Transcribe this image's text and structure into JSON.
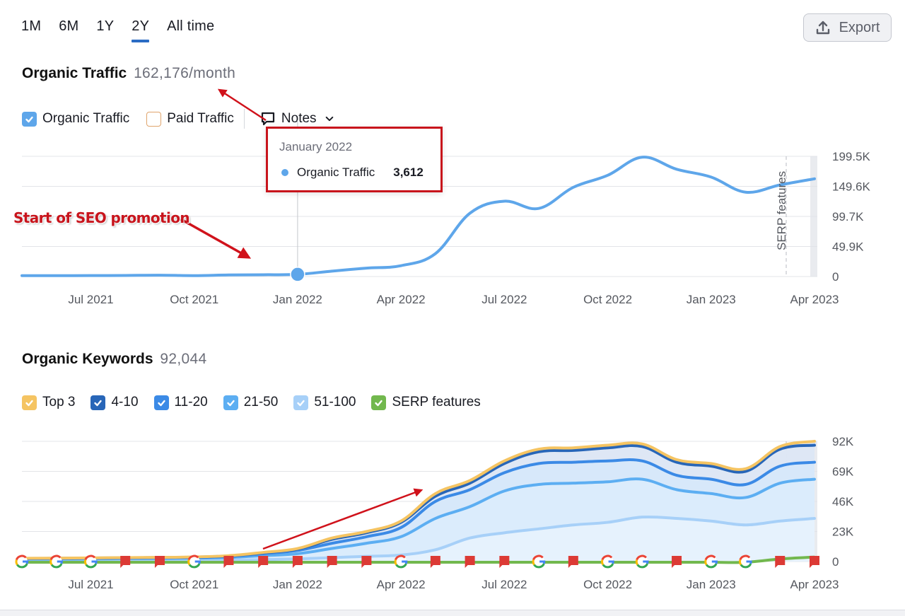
{
  "period_tabs": [
    {
      "label": "1M",
      "active": false
    },
    {
      "label": "6M",
      "active": false
    },
    {
      "label": "1Y",
      "active": false
    },
    {
      "label": "2Y",
      "active": true
    },
    {
      "label": "All time",
      "active": false
    }
  ],
  "export": {
    "label": "Export",
    "icon": "upload-icon"
  },
  "traffic": {
    "title": "Organic Traffic",
    "value": "162,176/month",
    "legend": {
      "organic": {
        "label": "Organic Traffic",
        "checked": true,
        "color": "#5ea6ea"
      },
      "paid": {
        "label": "Paid Traffic",
        "checked": false,
        "color": "#e0a46c"
      },
      "notes": {
        "label": "Notes",
        "icon": "comment-icon"
      }
    },
    "tooltip": {
      "date": "January 2022",
      "series": "Organic Traffic",
      "value": "3,612"
    },
    "annotation": "Start of SEO promotion",
    "serp_label": "SERP features"
  },
  "keywords": {
    "title": "Organic Keywords",
    "value": "92,044",
    "legend": [
      {
        "label": "Top 3",
        "color": "#f5c462"
      },
      {
        "label": "4-10",
        "color": "#2866b8"
      },
      {
        "label": "11-20",
        "color": "#3b8ae6"
      },
      {
        "label": "21-50",
        "color": "#5caef2"
      },
      {
        "label": "51-100",
        "color": "#a7d0f8"
      },
      {
        "label": "SERP features",
        "color": "#72b84e"
      }
    ]
  },
  "chart_data": [
    {
      "type": "line",
      "title": "Organic Traffic",
      "x": [
        "May 2021",
        "Jun 2021",
        "Jul 2021",
        "Aug 2021",
        "Sep 2021",
        "Oct 2021",
        "Nov 2021",
        "Dec 2021",
        "Jan 2022",
        "Feb 2022",
        "Mar 2022",
        "Apr 2022",
        "May 2022",
        "Jun 2022",
        "Jul 2022",
        "Aug 2022",
        "Sep 2022",
        "Oct 2022",
        "Nov 2022",
        "Dec 2022",
        "Jan 2023",
        "Feb 2023",
        "Mar 2023",
        "Apr 2023"
      ],
      "series": [
        {
          "name": "Organic Traffic",
          "color": "#5ea6ea",
          "values": [
            1500,
            1500,
            1600,
            1800,
            2200,
            1500,
            2600,
            3000,
            3612,
            9000,
            14000,
            18000,
            38000,
            105000,
            125000,
            113000,
            148000,
            168000,
            198000,
            178000,
            165000,
            140000,
            152000,
            162176
          ]
        }
      ],
      "xticks": [
        "Jul 2021",
        "Oct 2021",
        "Jan 2022",
        "Apr 2022",
        "Jul 2022",
        "Oct 2022",
        "Jan 2023",
        "Apr 2023"
      ],
      "yticks": [
        "0",
        "49.9K",
        "99.7K",
        "149.6K",
        "199.5K"
      ],
      "ylim": [
        0,
        199500
      ],
      "grid": true,
      "highlight": {
        "x": "Jan 2022",
        "value": 3612
      }
    },
    {
      "type": "area",
      "title": "Organic Keywords",
      "x": [
        "May 2021",
        "Jun 2021",
        "Jul 2021",
        "Aug 2021",
        "Sep 2021",
        "Oct 2021",
        "Nov 2021",
        "Dec 2021",
        "Jan 2022",
        "Feb 2022",
        "Mar 2022",
        "Apr 2022",
        "May 2022",
        "Jun 2022",
        "Jul 2022",
        "Aug 2022",
        "Sep 2022",
        "Oct 2022",
        "Nov 2022",
        "Dec 2022",
        "Jan 2023",
        "Feb 2023",
        "Mar 2023",
        "Apr 2023"
      ],
      "series": [
        {
          "name": "Top 3 (cumulative)",
          "color": "#f5c462",
          "values": [
            2500,
            2600,
            2800,
            3000,
            3200,
            3500,
            4500,
            7000,
            10000,
            18000,
            23000,
            31000,
            52000,
            62000,
            77000,
            86000,
            87000,
            89000,
            90000,
            78000,
            75000,
            71000,
            88000,
            92044
          ]
        },
        {
          "name": "4-10 (cumulative)",
          "color": "#2866b8",
          "values": [
            2400,
            2500,
            2700,
            2900,
            3100,
            3400,
            4300,
            6700,
            9500,
            17000,
            22000,
            30000,
            50000,
            60000,
            75000,
            84000,
            85000,
            87000,
            88000,
            76000,
            73000,
            69000,
            86000,
            89000
          ]
        },
        {
          "name": "11-20 (cumulative)",
          "color": "#3b8ae6",
          "values": [
            2200,
            2300,
            2500,
            2700,
            2900,
            3100,
            3900,
            6000,
            8500,
            14000,
            19000,
            26000,
            46000,
            55000,
            68000,
            75000,
            76000,
            77000,
            77000,
            66000,
            63000,
            59000,
            73000,
            76000
          ]
        },
        {
          "name": "21-50 (cumulative)",
          "color": "#5caef2",
          "values": [
            1800,
            1900,
            2000,
            2200,
            2400,
            2600,
            3100,
            4500,
            6000,
            10000,
            14000,
            19000,
            33000,
            42000,
            54000,
            59000,
            60000,
            61000,
            63000,
            55000,
            52000,
            49000,
            60000,
            63000
          ]
        },
        {
          "name": "51-100 (cumulative)",
          "color": "#a7d0f8",
          "values": [
            500,
            500,
            600,
            700,
            800,
            900,
            1000,
            1500,
            2000,
            3000,
            4000,
            5000,
            9000,
            18000,
            22000,
            25000,
            28000,
            30000,
            34000,
            33000,
            31000,
            28000,
            31000,
            33000
          ]
        },
        {
          "name": "SERP features",
          "color": "#72b84e",
          "values": [
            0,
            0,
            0,
            0,
            0,
            0,
            0,
            0,
            0,
            0,
            0,
            0,
            0,
            0,
            0,
            0,
            0,
            0,
            0,
            0,
            0,
            0,
            2500,
            4000
          ]
        }
      ],
      "markers": [
        "google",
        "google",
        "google",
        "note",
        "note",
        "google",
        "note",
        "note",
        "note",
        "note",
        "note",
        "google",
        "note",
        "note",
        "note",
        "google",
        "note",
        "google",
        "google",
        "note",
        "google",
        "google",
        "note",
        "note"
      ],
      "xticks": [
        "Jul 2021",
        "Oct 2021",
        "Jan 2022",
        "Apr 2022",
        "Jul 2022",
        "Oct 2022",
        "Jan 2023",
        "Apr 2023"
      ],
      "yticks": [
        "0",
        "23K",
        "46K",
        "69K",
        "92K"
      ],
      "ylim": [
        0,
        92000
      ],
      "grid": true
    }
  ]
}
